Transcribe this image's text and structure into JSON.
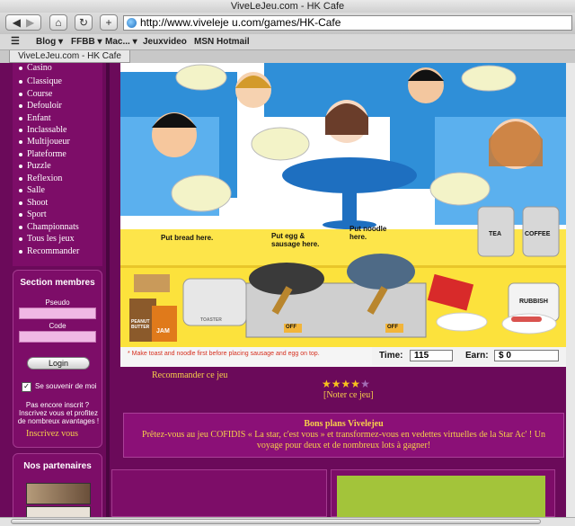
{
  "browser": {
    "window_title": "ViveLeJeu.com - HK Cafe",
    "url": "http://www.viveleje u.com/games/HK-Cafe",
    "bookmarks": [
      "Blog ▾",
      "FFBB ▾",
      "Mac... ▾",
      "Jeuxvideo",
      "MSN Hotmail"
    ],
    "tab_title": "ViveLeJeu.com - HK Cafe"
  },
  "sidebar": {
    "categories": [
      "Casino",
      "Classique",
      "Course",
      "Defouloir",
      "Enfant",
      "Inclassable",
      "Multijoueur",
      "Plateforme",
      "Puzzle",
      "Reflexion",
      "Salle",
      "Shoot",
      "Sport",
      "Championnats",
      "Tous les jeux",
      "Recommander"
    ]
  },
  "members": {
    "title": "Section membres",
    "pseudo_label": "Pseudo",
    "code_label": "Code",
    "login_label": "Login",
    "remember_label": "Se souvenir de moi",
    "not_registered": "Pas encore inscrit ?",
    "register_promo": "Inscrivez vous et profitez de nombreux avantages !",
    "register_link": "Inscrivez vous"
  },
  "partners": {
    "title": "Nos partenaires"
  },
  "game": {
    "bubble_bread": "Put bread here.",
    "bubble_egg": "Put egg & sausage here.",
    "bubble_noodle": "Put noodle here.",
    "label_tea": "TEA",
    "label_coffee": "COFFEE",
    "label_rubbish": "RUBBISH",
    "label_toaster": "TOASTER",
    "label_peanut": "PEANUT BUTTER",
    "label_jam": "JAM",
    "label_off": "OFF",
    "hint": "* Make toast and noodle first before placing sausage and egg on top.",
    "time_label": "Time:",
    "time_value": "115",
    "earn_label": "Earn:",
    "earn_value": "$ 0"
  },
  "below_game": {
    "recommend_link": "Recommander ce jeu",
    "rating_stars": 4,
    "rating_max": 5,
    "rate_link": "[Noter ce jeu]"
  },
  "bons_plans": {
    "title": "Bons plans Vivelejeu",
    "text": "Prêtez-vous au jeu COFIDIS « La star, c'est vous » et transformez-vous en vedettes virtuelles de la Star Ac' ! Un voyage pour deux et de nombreux lots à gagner!"
  },
  "colors": {
    "page_bg": "#6b0a5a",
    "panel_bg": "#7d0d68",
    "link_yellow": "#f7d04a",
    "game_yellow": "#fde54a",
    "game_blue": "#2f8fd8"
  }
}
